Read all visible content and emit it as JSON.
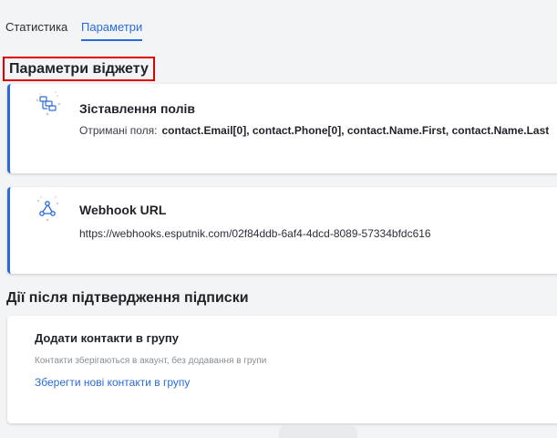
{
  "tabs": [
    {
      "label": "Статистика",
      "active": false
    },
    {
      "label": "Параметри",
      "active": true
    }
  ],
  "widget_params": {
    "title": "Параметри віджету",
    "field_mapping": {
      "title": "Зіставлення полів",
      "received_label": "Отримані поля:",
      "received_value": "contact.Email[0], contact.Phone[0], contact.Name.First, contact.Name.Last",
      "icon": "field-mapping-icon"
    },
    "webhook": {
      "title": "Webhook URL",
      "url": "https://webhooks.esputnik.com/02f84ddb-6af4-4dcd-8089-57334bfdc616",
      "icon": "webhook-icon"
    }
  },
  "actions": {
    "title": "Дії після підтвердження підписки",
    "add_to_group": {
      "title": "Додати контакти в групу",
      "hint": "Контакти зберігаються в акаунт, без додавання в групи",
      "link": "Зберегти нові контакти в групу"
    }
  },
  "colors": {
    "accent": "#2a6bd9",
    "highlight_border": "#e00000",
    "background": "#f3f4f6"
  }
}
